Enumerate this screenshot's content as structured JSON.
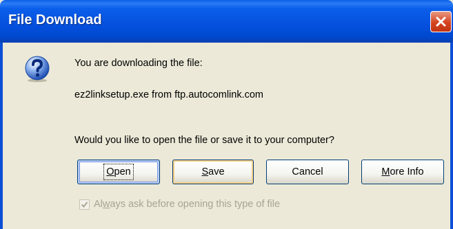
{
  "window": {
    "title": "File Download",
    "close_icon": "close-icon"
  },
  "dialog": {
    "icon": "question-icon",
    "line1": "You are downloading the file:",
    "file_info": "ez2linksetup.exe from ftp.autocomlink.com",
    "prompt": "Would you like to open the file or save it to your computer?"
  },
  "buttons": {
    "open": {
      "mnemonic": "O",
      "rest": "pen"
    },
    "save": {
      "mnemonic": "S",
      "rest": "ave"
    },
    "cancel": {
      "label": "Cancel"
    },
    "more_info": {
      "mnemonic": "M",
      "rest": "ore Info"
    }
  },
  "checkbox": {
    "label_pre": "Al",
    "label_mnemonic": "w",
    "label_post": "ays ask before opening this type of file",
    "checked": true,
    "enabled": false
  },
  "colors": {
    "titlebar": "#0550dd",
    "close_button": "#d5431f",
    "dialog_background": "#ece9d8"
  }
}
